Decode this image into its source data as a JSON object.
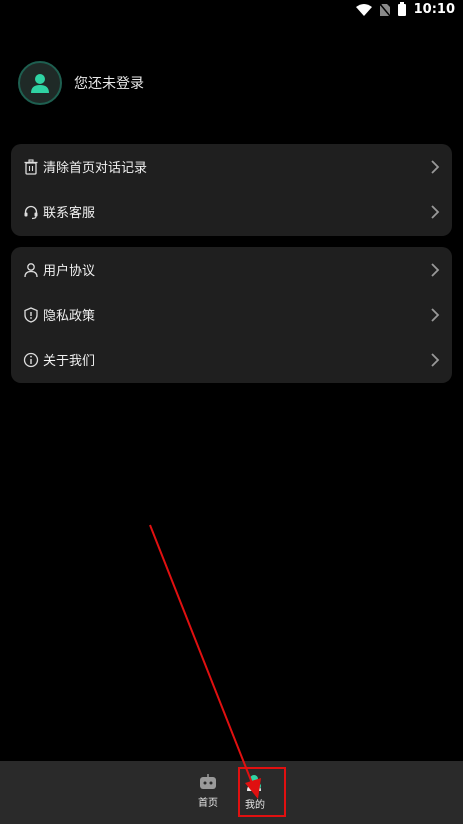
{
  "status_bar": {
    "time": "10:10"
  },
  "profile": {
    "name": "您还未登录"
  },
  "card1": {
    "items": [
      {
        "label": "清除首页对话记录",
        "icon": "trash-icon"
      },
      {
        "label": "联系客服",
        "icon": "headset-icon"
      }
    ]
  },
  "card2": {
    "items": [
      {
        "label": "用户协议",
        "icon": "user-agreement-icon"
      },
      {
        "label": "隐私政策",
        "icon": "shield-icon"
      },
      {
        "label": "关于我们",
        "icon": "info-icon"
      }
    ]
  },
  "bottom_nav": {
    "items": [
      {
        "label": "首页",
        "icon": "robot-icon"
      },
      {
        "label": "我的",
        "icon": "profile-icon",
        "active": true
      }
    ]
  },
  "colors": {
    "accent": "#2fd3a3",
    "annotation": "#e01010",
    "card_bg": "#1f1f1f",
    "nav_bg": "#2a2a2a"
  }
}
